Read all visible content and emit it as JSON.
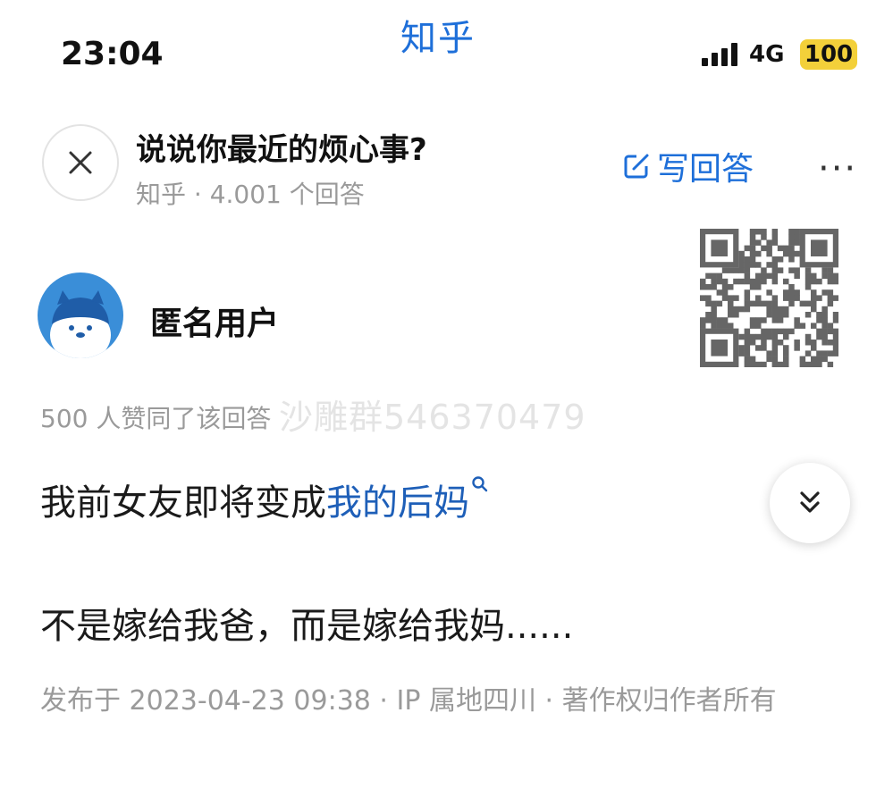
{
  "status_bar": {
    "app_name": "知乎",
    "time": "23:04",
    "network": "4G",
    "battery": "100",
    "icons": [
      "signal-icon",
      "battery-icon"
    ]
  },
  "header": {
    "title": "说说你最近的烦心事?",
    "meta": "知乎 · 4.001 个回答",
    "write_answer_label": "写回答",
    "more_label": "···",
    "icons": [
      "close-icon",
      "edit-icon",
      "more-icon"
    ]
  },
  "author": {
    "name": "匿名用户",
    "icon": "anonymous-avatar"
  },
  "votes_text": "500 人赞同了该回答",
  "watermark": "沙雕群546370479",
  "content": {
    "line1_prefix": "我前女友即将变成",
    "line1_link": "我的后妈",
    "line2": "不是嫁给我爸，而是嫁给我妈......"
  },
  "footer": {
    "meta": "发布于 2023-04-23 09:38 · IP 属地四川 · 著作权归作者所有"
  },
  "colors": {
    "brand_blue": "#1e6fd9",
    "link_blue": "#1e5fb8",
    "battery_yellow": "#f3d03a",
    "meta_gray": "#9a9a9a"
  }
}
